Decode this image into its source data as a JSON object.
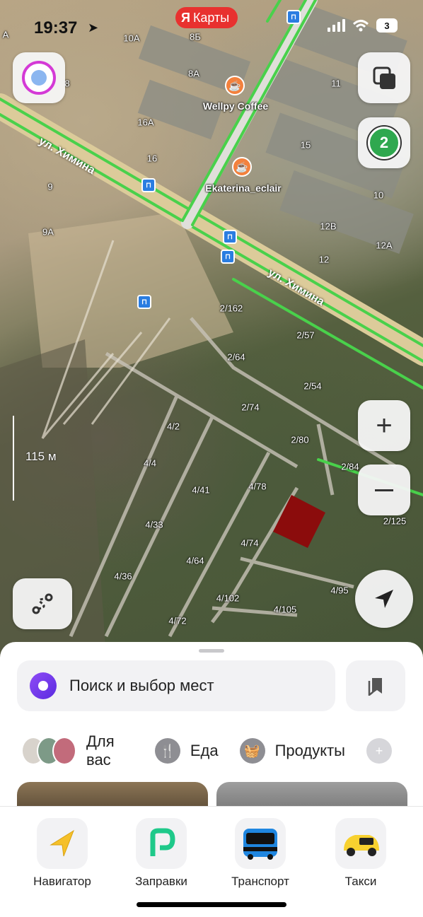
{
  "status_bar": {
    "time": "19:37",
    "app_badge": "Карты",
    "ya_letter": "Я",
    "battery": "3"
  },
  "map": {
    "house_labels": [
      "10А",
      "8",
      "8Б",
      "8А",
      "16А",
      "16",
      "9",
      "9А",
      "А",
      "11",
      "15",
      "10",
      "12В",
      "12А",
      "12",
      "2/162",
      "2/57",
      "2/64",
      "2/54",
      "2/74",
      "2/80",
      "2/84",
      "4/2",
      "4/4",
      "4/41",
      "4/78",
      "4/33",
      "4/74",
      "4/64",
      "4/36",
      "4/102",
      "4/105",
      "4/95",
      "4/72",
      "2/125",
      "4/4"
    ],
    "pois": [
      {
        "name": "Wellpy Coffee",
        "icon": "coffee-icon"
      },
      {
        "name": "Ekaterina_eclair",
        "icon": "coffee-icon"
      }
    ],
    "streets": [
      "ул. Химина",
      "ул. Химина"
    ],
    "scale_label": "115 м",
    "layers_badge": "2",
    "area_color": "#8b0c0c"
  },
  "sheet": {
    "search_placeholder": "Поиск и выбор мест",
    "chips": [
      {
        "label": "Для вас",
        "icon": "avatars"
      },
      {
        "label": "Еда",
        "icon": "fork-knife-icon"
      },
      {
        "label": "Продукты",
        "icon": "basket-icon"
      }
    ]
  },
  "tabbar": {
    "items": [
      {
        "label": "Навигатор",
        "icon": "navigator-icon"
      },
      {
        "label": "Заправки",
        "icon": "gas-station-icon"
      },
      {
        "label": "Транспорт",
        "icon": "bus-icon"
      },
      {
        "label": "Такси",
        "icon": "taxi-icon"
      }
    ]
  },
  "colors": {
    "brand_red": "#e8312f",
    "road_green": "#49d14b",
    "alice_purple": "#7a3cf0",
    "poi_orange": "#f3813d",
    "transit_blue": "#2a7de1"
  }
}
